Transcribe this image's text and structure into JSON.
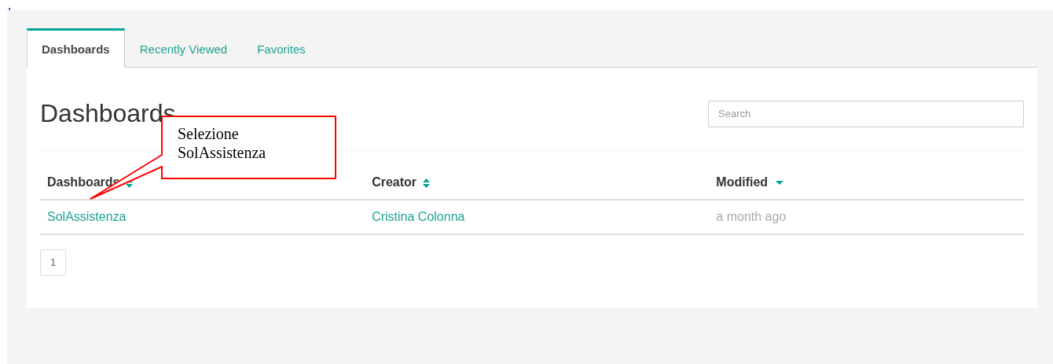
{
  "tabs": [
    {
      "label": "Dashboards",
      "selected": true
    },
    {
      "label": "Recently Viewed",
      "selected": false
    },
    {
      "label": "Favorites",
      "selected": false
    }
  ],
  "heading": "Dashboards",
  "search": {
    "placeholder": "Search"
  },
  "table": {
    "columns": [
      {
        "label": "Dashboards",
        "kind": "sortable"
      },
      {
        "label": "Creator",
        "kind": "sortable"
      },
      {
        "label": "Modified",
        "kind": "sorted"
      }
    ],
    "rows": [
      {
        "dashboard": "SolAssistenza",
        "creator": "Cristina Colonna",
        "modified": "a month ago"
      }
    ]
  },
  "pagination": [
    "1"
  ],
  "callout": {
    "text": "Selezione SolAssistenza"
  }
}
